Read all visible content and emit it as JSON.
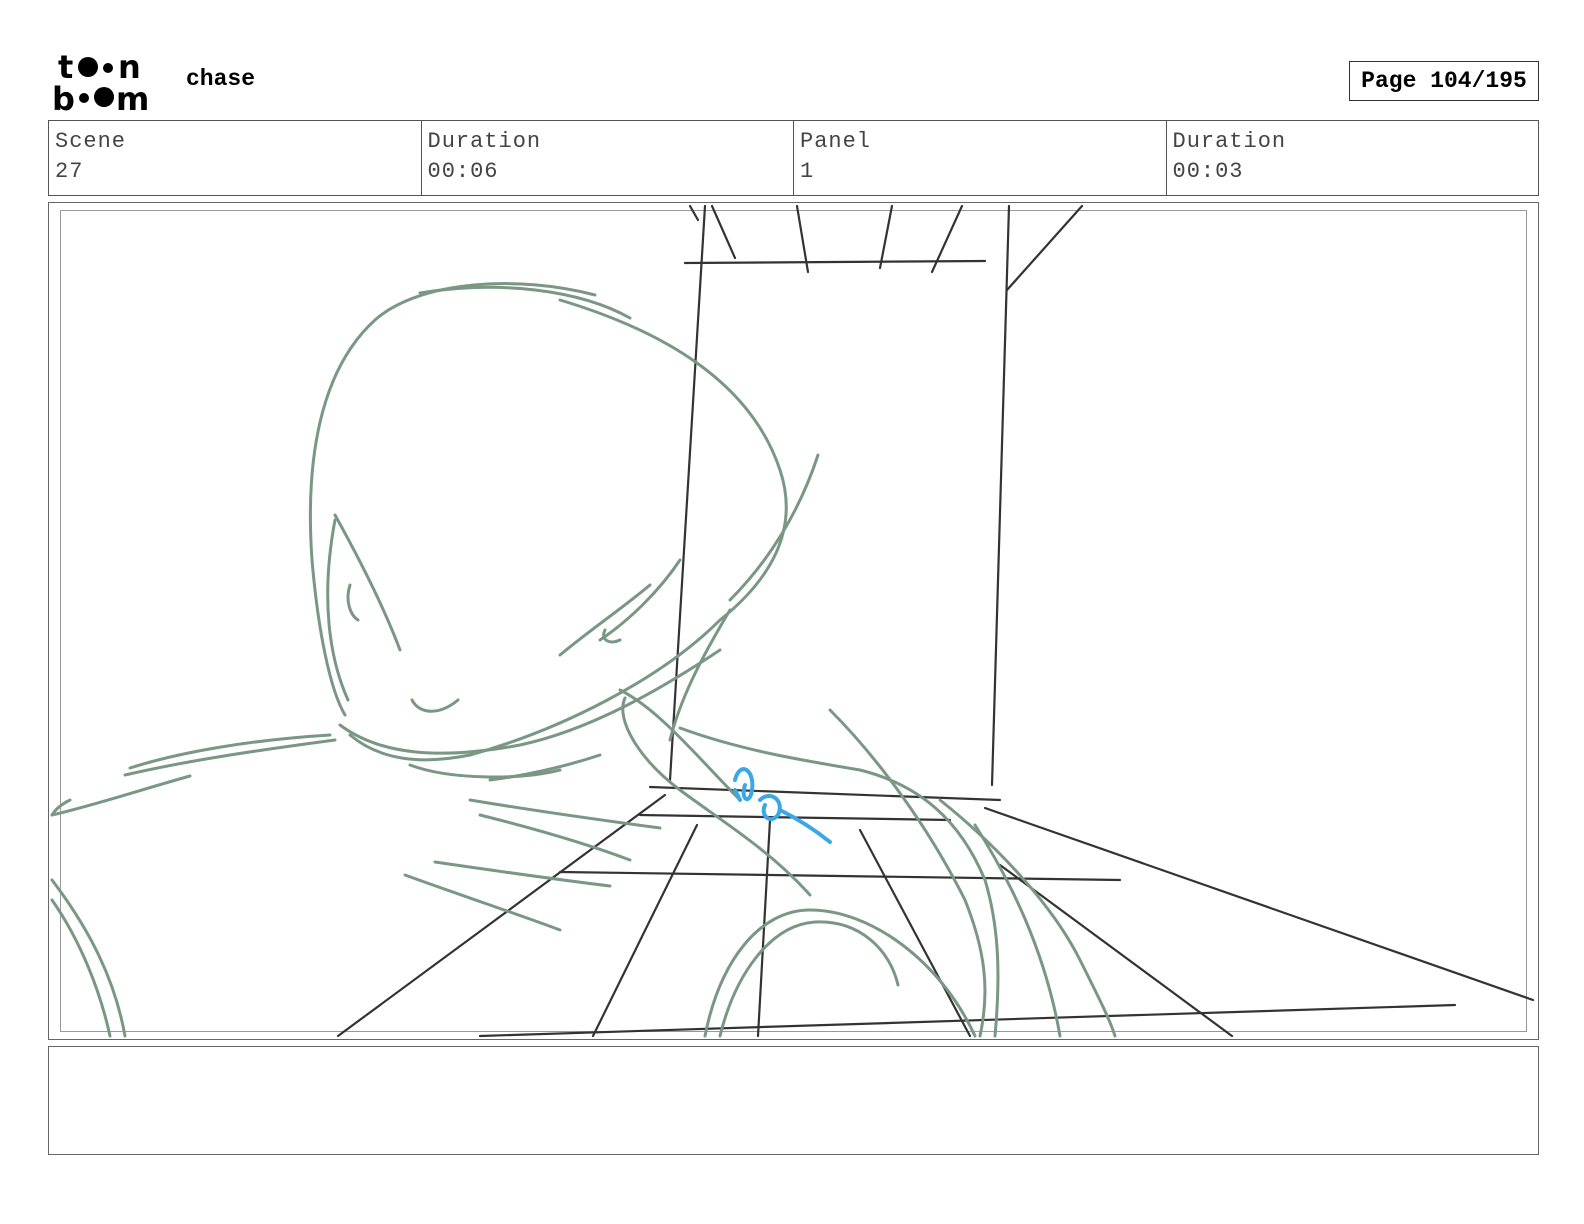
{
  "brand": {
    "logo_line1": "toon",
    "logo_line2": "boom"
  },
  "header": {
    "project": "chase",
    "page": "Page 104/195"
  },
  "info": [
    {
      "label": "Scene",
      "value": "27"
    },
    {
      "label": "Duration",
      "value": "00:06"
    },
    {
      "label": "Panel",
      "value": "1"
    },
    {
      "label": "Duration",
      "value": "00:03"
    }
  ],
  "colors": {
    "character": "#7a9784",
    "layout": "#333333",
    "note": "#3aa7e8"
  },
  "notes": ""
}
